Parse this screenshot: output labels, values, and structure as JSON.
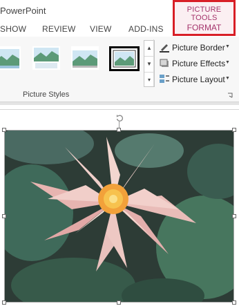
{
  "app": {
    "title": "PowerPoint"
  },
  "tabs": [
    "SHOW",
    "REVIEW",
    "VIEW",
    "ADD-INS"
  ],
  "contextual": {
    "group_title": "PICTURE TOOLS",
    "tab": "FORMAT",
    "border_color": "#d81e26",
    "text_color": "#a4336b"
  },
  "ribbon": {
    "group_label": "Picture Styles",
    "picture_styles": [
      "style-1",
      "style-2",
      "style-3",
      "style-4"
    ],
    "selected_style": 4,
    "commands": [
      {
        "label": "Picture Border",
        "icon": "picture-border-icon"
      },
      {
        "label": "Picture Effects",
        "icon": "picture-effects-icon"
      },
      {
        "label": "Picture Layout",
        "icon": "picture-layout-icon"
      }
    ]
  },
  "slide": {
    "picture": "water-lily-photo"
  }
}
